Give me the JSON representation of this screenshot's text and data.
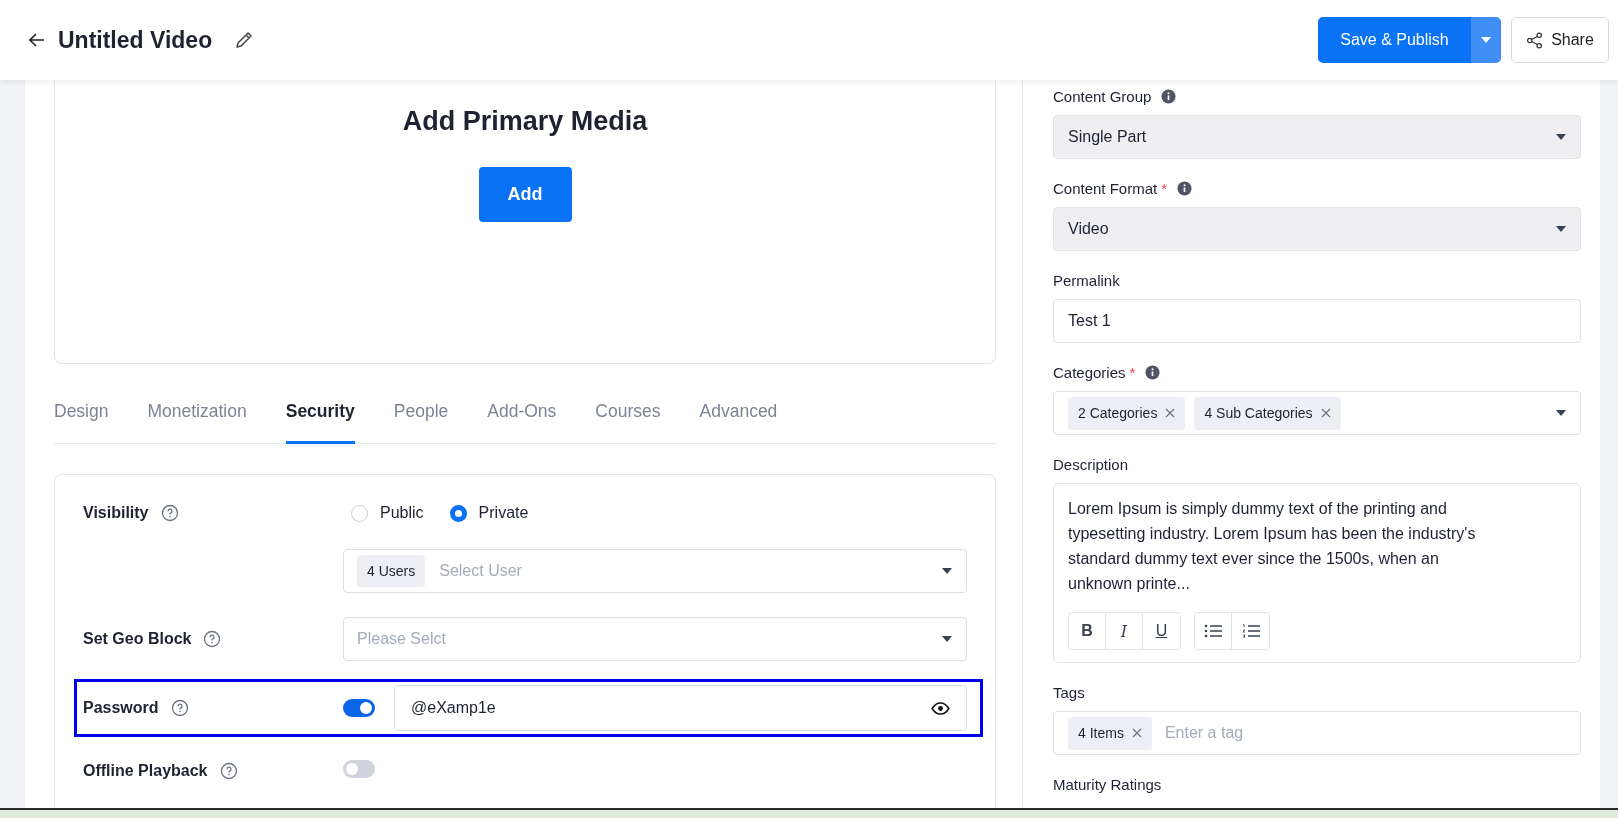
{
  "header": {
    "title": "Untitled Video",
    "primary_button": "Save & Publish",
    "share_button": "Share"
  },
  "media": {
    "title": "Add Primary Media",
    "button": "Add"
  },
  "tabs": [
    {
      "label": "Design",
      "selected": false
    },
    {
      "label": "Monetization",
      "selected": false
    },
    {
      "label": "Security",
      "selected": true
    },
    {
      "label": "People",
      "selected": false
    },
    {
      "label": "Add-Ons",
      "selected": false
    },
    {
      "label": "Courses",
      "selected": false
    },
    {
      "label": "Advanced",
      "selected": false
    }
  ],
  "security": {
    "visibility": {
      "label": "Visibility",
      "options": [
        {
          "label": "Public",
          "selected": false
        },
        {
          "label": "Private",
          "selected": true
        }
      ],
      "users_chip": "4 Users",
      "user_placeholder": "Select User"
    },
    "geo_block": {
      "label": "Set Geo Block",
      "placeholder": "Please Selct"
    },
    "password": {
      "label": "Password",
      "on": true,
      "value": "@eXamp1e",
      "highlighted": true
    },
    "offline_playback": {
      "label": "Offline Playback",
      "on": false
    }
  },
  "details": [
    {
      "kind": "select",
      "label": "Content Group",
      "info": true,
      "value": "Single Part"
    },
    {
      "kind": "select",
      "label": "Content Format",
      "required_mark": "*",
      "info": true,
      "value": "Video"
    },
    {
      "kind": "text",
      "label": "Permalink",
      "info": false,
      "value": "Test 1"
    },
    {
      "kind": "chips",
      "label": "Categories",
      "required_mark": "*",
      "info": true,
      "chips": [
        "2 Categories",
        "4 Sub Categories"
      ]
    },
    {
      "kind": "editor",
      "label": "Description",
      "info": false,
      "value": "Lorem Ipsum is simply dummy text of the printing and typesetting industry. Lorem Ipsum has been the industry's standard dummy text ever since the 1500s, when an unknown printe...",
      "format_buttons": [
        {
          "label": "B",
          "kind": "bold"
        },
        {
          "label": "I",
          "kind": "italic"
        },
        {
          "label": "U",
          "kind": "underline"
        }
      ]
    },
    {
      "kind": "tags",
      "label": "Tags",
      "info": false,
      "chips": [
        "4 Items"
      ],
      "placeholder": "Enter a tag"
    },
    {
      "kind": "heading",
      "label": "Maturity Ratings",
      "info": false
    }
  ]
}
